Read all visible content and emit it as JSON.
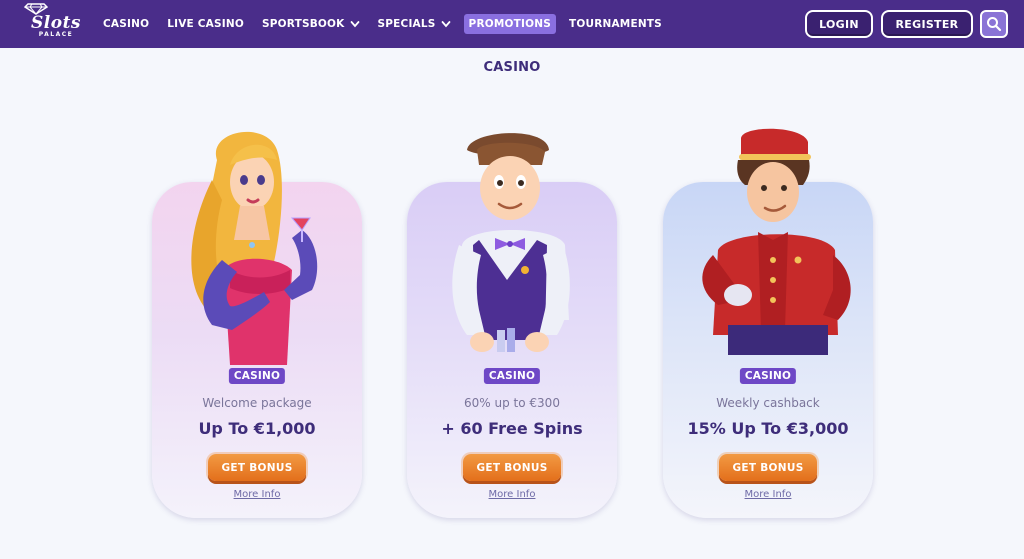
{
  "brand": {
    "logo_word": "Slots",
    "logo_sub": "PALACE"
  },
  "nav": {
    "items": [
      {
        "label": "CASINO"
      },
      {
        "label": "LIVE CASINO"
      },
      {
        "label": "SPORTSBOOK"
      },
      {
        "label": "SPECIALS"
      },
      {
        "label": "PROMOTIONS"
      },
      {
        "label": "TOURNAMENTS"
      }
    ],
    "active_index": 4
  },
  "header": {
    "login_label": "LOGIN",
    "register_label": "REGISTER",
    "search_icon": "search-icon"
  },
  "section": {
    "title": "CASINO"
  },
  "offers": [
    {
      "badge": "CASINO",
      "subtitle": "Welcome package",
      "headline": "Up To €1,000",
      "button": "GET BONUS",
      "more": "More Info",
      "character": "lady-with-cocktail"
    },
    {
      "badge": "CASINO",
      "subtitle": "60% up to €300",
      "headline": "+ 60 Free Spins",
      "button": "GET BONUS",
      "more": "More Info",
      "character": "croupier"
    },
    {
      "badge": "CASINO",
      "subtitle": "Weekly cashback",
      "headline": "15% Up To €3,000",
      "button": "GET BONUS",
      "more": "More Info",
      "character": "bellboy"
    }
  ],
  "colors": {
    "header_bg": "#4a2d8a",
    "accent_purple": "#6e48c6",
    "cta_orange": "#e36f1b",
    "title_text": "#3e2d7a"
  }
}
